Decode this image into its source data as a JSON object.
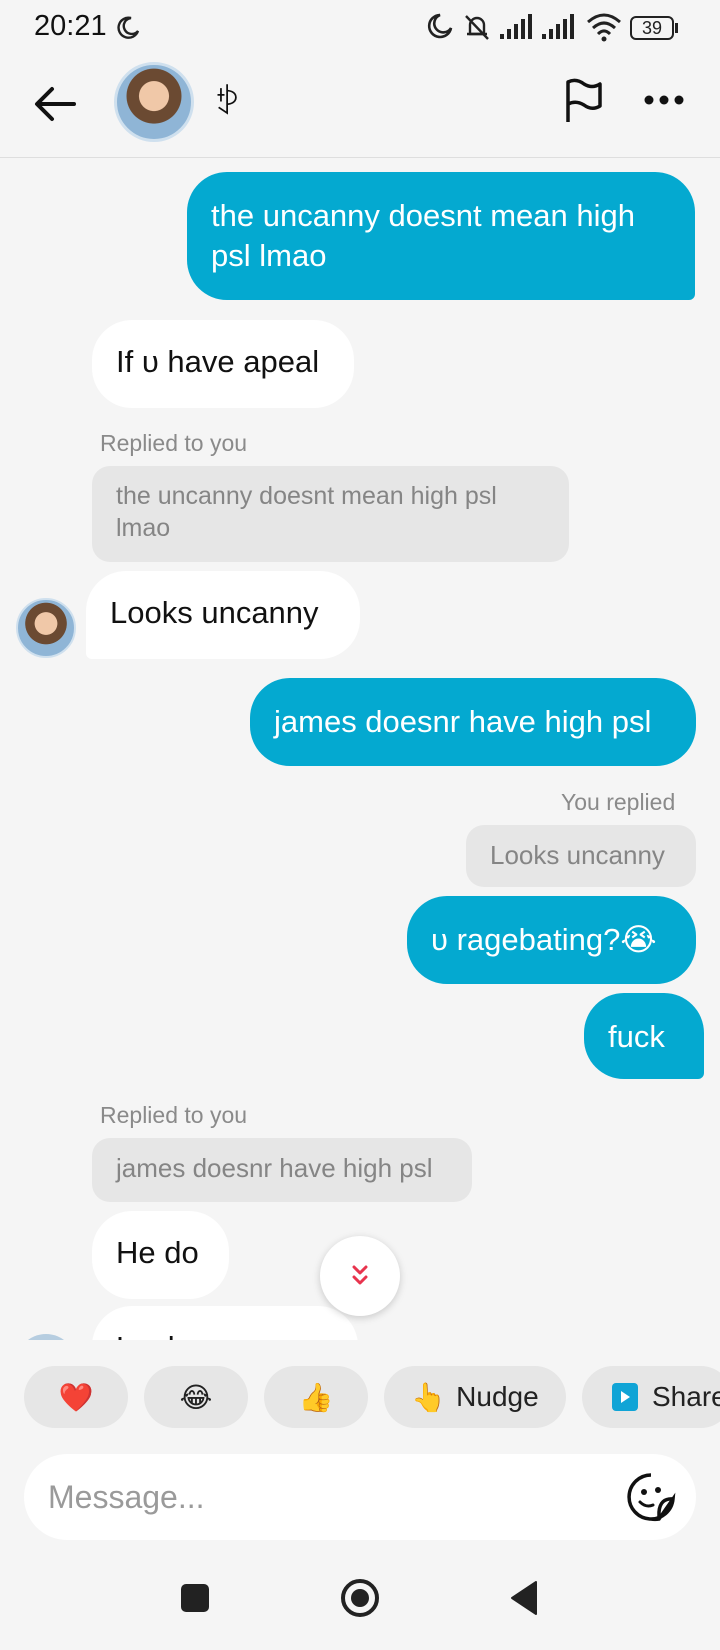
{
  "status_bar": {
    "time": "20:21",
    "battery": "39"
  },
  "header": {
    "contact_name": "ꉣ"
  },
  "messages": {
    "m1": {
      "line1": "the uncanny doesnt mean high",
      "line2": "psl lmao"
    },
    "m2": {
      "text": "If ᴜ have apeal"
    },
    "m3": {
      "reply_label": "Replied to you",
      "quote_line1": "the uncanny doesnt mean high psl",
      "quote_line2": "lmao",
      "text": "Looks uncanny"
    },
    "m4": {
      "text": "james doesnr have high psl"
    },
    "m5": {
      "reply_label": "You replied",
      "quote": "Looks uncanny",
      "text": "ᴜ ragebating?😭"
    },
    "m6": {
      "text": "fuck"
    },
    "m7": {
      "reply_label": "Replied to you",
      "quote": "james doesnr have high psl",
      "text": "He do"
    },
    "m8": {
      "text": "Looks uncanny"
    }
  },
  "quick_actions": [
    {
      "emoji": "❤️"
    },
    {
      "emoji": "😂"
    },
    {
      "emoji": "👍"
    },
    {
      "emoji": "👆",
      "label": "Nudge"
    },
    {
      "label": "Share"
    }
  ],
  "composer": {
    "placeholder": "Message..."
  },
  "colors": {
    "outgoing_bubble": "#04a9d0",
    "incoming_bubble": "#ffffff",
    "background": "#f5f5f5",
    "quote_bg": "#e6e6e6",
    "scroll_chevron": "#e8344e"
  }
}
